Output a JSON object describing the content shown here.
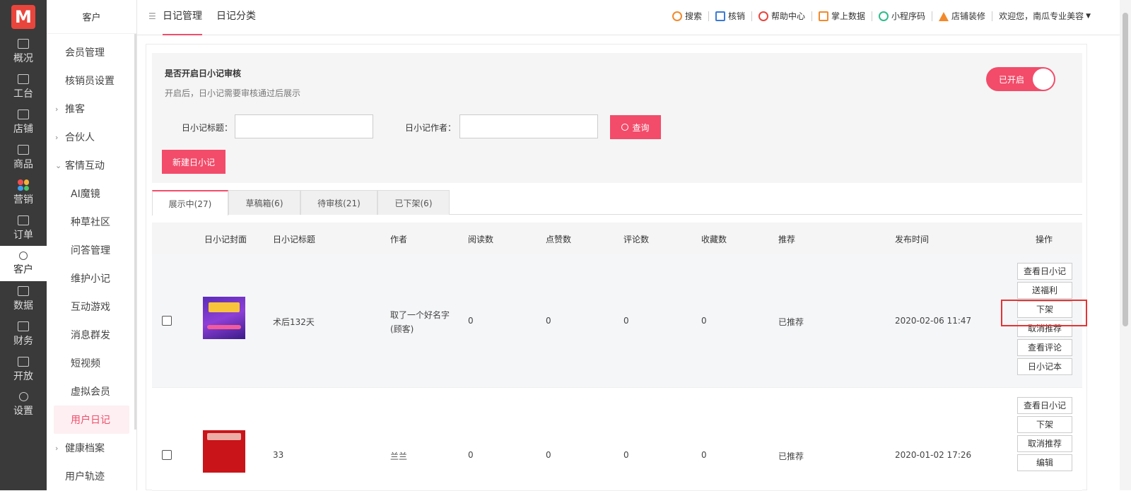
{
  "rail": {
    "logo": "M",
    "items": [
      {
        "label": "概况",
        "icon": "chart-icon"
      },
      {
        "label": "工台",
        "icon": "monitor-icon"
      },
      {
        "label": "店铺",
        "icon": "store-icon"
      },
      {
        "label": "商品",
        "icon": "bag-icon"
      },
      {
        "label": "营销",
        "icon": "dots-icon"
      },
      {
        "label": "订单",
        "icon": "order-icon"
      },
      {
        "label": "客户",
        "icon": "user-icon"
      },
      {
        "label": "数据",
        "icon": "data-icon"
      },
      {
        "label": "财务",
        "icon": "finance-icon"
      },
      {
        "label": "开放",
        "icon": "code-icon"
      },
      {
        "label": "设置",
        "icon": "gear-icon"
      }
    ]
  },
  "sidebar": {
    "title": "客户",
    "items": [
      {
        "label": "会员管理",
        "kind": "item"
      },
      {
        "label": "核销员设置",
        "kind": "item"
      },
      {
        "label": "推客",
        "kind": "group"
      },
      {
        "label": "合伙人",
        "kind": "group"
      },
      {
        "label": "客情互动",
        "kind": "group-open"
      },
      {
        "label": "AI魔镜",
        "kind": "sub"
      },
      {
        "label": "种草社区",
        "kind": "sub"
      },
      {
        "label": "问答管理",
        "kind": "sub"
      },
      {
        "label": "维护小记",
        "kind": "sub"
      },
      {
        "label": "互动游戏",
        "kind": "sub"
      },
      {
        "label": "消息群发",
        "kind": "sub"
      },
      {
        "label": "短视频",
        "kind": "sub"
      },
      {
        "label": "虚拟会员",
        "kind": "sub"
      },
      {
        "label": "用户日记",
        "kind": "active"
      },
      {
        "label": "健康档案",
        "kind": "group"
      },
      {
        "label": "用户轨迹",
        "kind": "item"
      }
    ]
  },
  "header": {
    "tabs": [
      {
        "label": "日记管理",
        "active": true
      },
      {
        "label": "日记分类",
        "active": false
      }
    ],
    "tools": [
      {
        "label": "搜索"
      },
      {
        "label": "核销"
      },
      {
        "label": "帮助中心"
      },
      {
        "label": "掌上数据"
      },
      {
        "label": "小程序码"
      },
      {
        "label": "店铺装修"
      }
    ],
    "welcome": "欢迎您，南瓜专业美容"
  },
  "audit": {
    "title": "是否开启日小记审核",
    "desc": "开启后，日小记需要审核通过后展示",
    "switch_label": "已开启"
  },
  "filter": {
    "title_label": "日小记标题：",
    "author_label": "日小记作者：",
    "query_button": "查询",
    "new_button": "新建日小记"
  },
  "status_tabs": [
    {
      "label": "展示中(27)",
      "active": true
    },
    {
      "label": "草稿箱(6)",
      "active": false
    },
    {
      "label": "待审核(21)",
      "active": false
    },
    {
      "label": "已下架(6)",
      "active": false
    }
  ],
  "table": {
    "columns": [
      "日小记封面",
      "日小记标题",
      "作者",
      "阅读数",
      "点赞数",
      "评论数",
      "收藏数",
      "推荐",
      "发布时间",
      "操作"
    ],
    "rows": [
      {
        "title": "术后132天",
        "author_line1": "取了一个好名字",
        "author_line2": "(顾客)",
        "reads": "0",
        "likes": "0",
        "comments": "0",
        "favorites": "0",
        "recommend": "已推荐",
        "time": "2020-02-06 11:47",
        "ops": [
          "查看日小记",
          "送福利",
          "下架",
          "取消推荐",
          "查看评论",
          "日小记本"
        ]
      },
      {
        "title": "33",
        "author_line1": "兰兰",
        "author_line2": "",
        "reads": "0",
        "likes": "0",
        "comments": "0",
        "favorites": "0",
        "recommend": "已推荐",
        "time": "2020-01-02 17:26",
        "ops": [
          "查看日小记",
          "下架",
          "取消推荐",
          "编辑"
        ]
      }
    ]
  },
  "colors": {
    "accent": "#f24c6a",
    "rail_bg": "#3a3a3a",
    "highlight": "#e53333"
  }
}
